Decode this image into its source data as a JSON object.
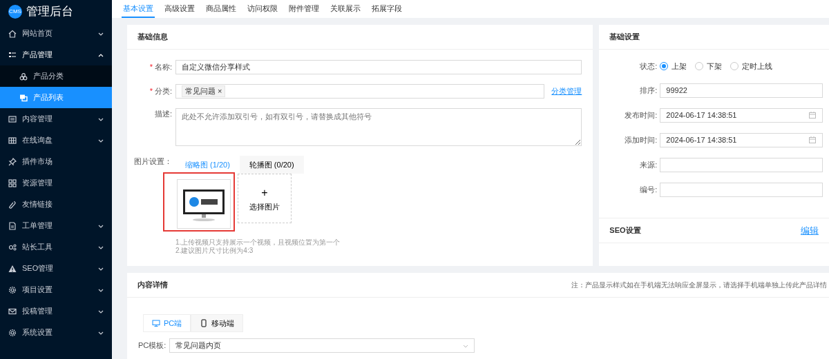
{
  "sidebar": {
    "logo_badge": "CMS",
    "title": "管理后台",
    "items": [
      {
        "label": "网站首页",
        "expanded": false
      },
      {
        "label": "产品管理",
        "expanded": true,
        "children": [
          {
            "label": "产品分类",
            "selected": false
          },
          {
            "label": "产品列表",
            "selected": true
          }
        ]
      },
      {
        "label": "内容管理",
        "expanded": false
      },
      {
        "label": "在线询盘",
        "expanded": false
      },
      {
        "label": "插件市场"
      },
      {
        "label": "资源管理"
      },
      {
        "label": "友情链接"
      },
      {
        "label": "工单管理",
        "expanded": false
      },
      {
        "label": "站长工具",
        "expanded": false
      },
      {
        "label": "SEO管理",
        "expanded": false
      },
      {
        "label": "项目设置",
        "expanded": false
      },
      {
        "label": "投稿管理",
        "expanded": false
      },
      {
        "label": "系统设置",
        "expanded": false
      }
    ]
  },
  "tabs": [
    {
      "label": "基本设置",
      "selected": true
    },
    {
      "label": "高级设置",
      "selected": false
    },
    {
      "label": "商品属性",
      "selected": false
    },
    {
      "label": "访问权限",
      "selected": false
    },
    {
      "label": "附件管理",
      "selected": false
    },
    {
      "label": "关联展示",
      "selected": false
    },
    {
      "label": "拓展字段",
      "selected": false
    }
  ],
  "basic_info": {
    "title": "基础信息",
    "name": {
      "label": "名称:",
      "required_mark": "*",
      "value": "自定义微信分享样式"
    },
    "category": {
      "label": "分类:",
      "required_mark": "*",
      "tags": [
        "常见问题"
      ],
      "tag_remove": "×",
      "link": "分类管理"
    },
    "description": {
      "label": "描述:",
      "placeholder": "此处不允许添加双引号，如有双引号，请替换成其他符号"
    },
    "images": {
      "label": "图片设置：",
      "tabs": [
        {
          "label": "缩略图 (1/20)",
          "selected": true
        },
        {
          "label": "轮播图 (0/20)",
          "selected": false
        }
      ],
      "items": [
        {
          "kind": "picture",
          "highlighted": true
        }
      ],
      "add": {
        "plus": "+",
        "label": "选择图片"
      },
      "hints": [
        "1.上传视频只支持展示一个视频，且视频位置为第一个",
        "2.建议图片尺寸比例为4:3"
      ]
    }
  },
  "basic_settings": {
    "title": "基础设置",
    "status": {
      "label": "状态:",
      "options": [
        {
          "label": "上架",
          "selected": true
        },
        {
          "label": "下架",
          "selected": false
        },
        {
          "label": "定时上线",
          "selected": false
        }
      ]
    },
    "fields": [
      {
        "kind": "text",
        "label": "排序:",
        "value": "99922"
      },
      {
        "kind": "date",
        "label": "发布时间:",
        "value": "2024-06-17 14:38:51"
      },
      {
        "kind": "date",
        "label": "添加时间:",
        "value": "2024-06-17 14:38:51"
      },
      {
        "kind": "text",
        "label": "来源:"
      },
      {
        "kind": "text",
        "label": "编号:"
      }
    ]
  },
  "seo": {
    "title": "SEO设置",
    "action": "编辑"
  },
  "content_detail": {
    "title": "内容详情",
    "note": "注：产品显示样式如在手机端无法响应全屏显示，请选择手机端单独上传此产品详情",
    "tabs": [
      {
        "label": "PC端",
        "selected": true
      },
      {
        "label": "移动端",
        "selected": false
      }
    ],
    "template": {
      "label": "PC模板:",
      "value": "常见问题内页"
    }
  }
}
